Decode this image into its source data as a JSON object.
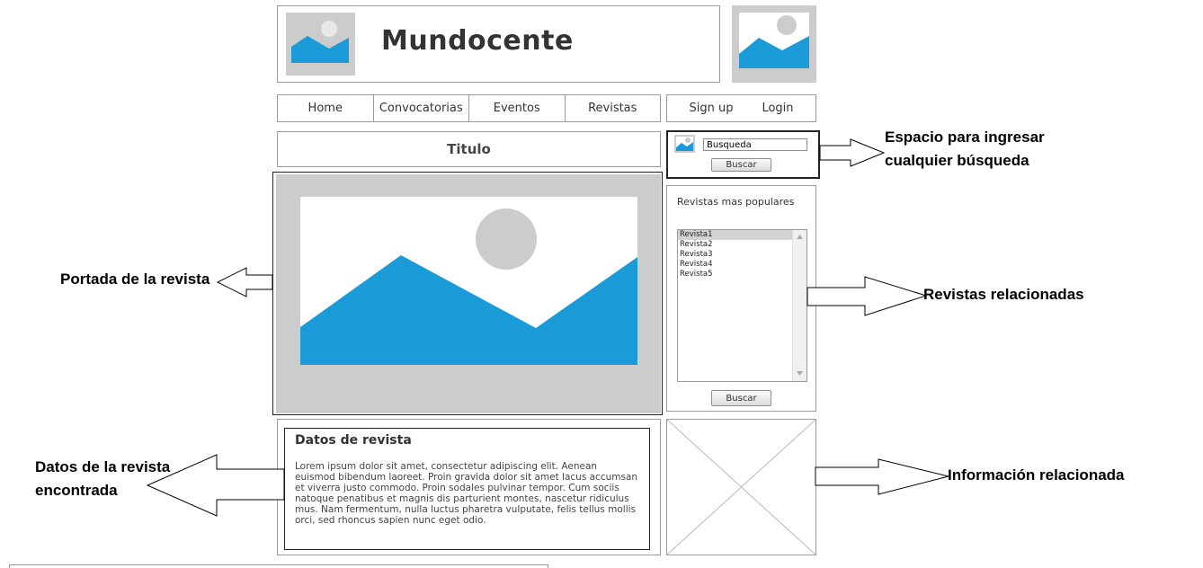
{
  "header": {
    "site_title": "Mundocente"
  },
  "nav": {
    "items": [
      {
        "label": "Home"
      },
      {
        "label": "Convocatorias"
      },
      {
        "label": "Eventos"
      },
      {
        "label": "Revistas"
      }
    ],
    "signup_label": "Sign up",
    "login_label": "Login"
  },
  "main": {
    "title": "Titulo"
  },
  "search": {
    "value": "Busqueda",
    "button_label": "Buscar"
  },
  "popular": {
    "heading": "Revistas mas populares",
    "items": [
      "Revista1",
      "Revista2",
      "Revista3",
      "Revista4",
      "Revista5"
    ],
    "selected": "Revista1",
    "button_label": "Buscar"
  },
  "details": {
    "heading": "Datos de revista",
    "body": "Lorem ipsum dolor sit amet, consectetur adipiscing elit. Aenean euismod bibendum laoreet. Proin gravida dolor sit amet lacus accumsan et viverra justo commodo. Proin sodales pulvinar tempor. Cum sociis natoque penatibus et magnis dis parturient montes, nascetur ridiculus mus. Nam fermentum, nulla luctus pharetra vulputate, felis tellus mollis orci, sed rhoncus sapien nunc eget odio."
  },
  "annotations": {
    "search_line1": "Espacio para ingresar",
    "search_line2": "cualquier búsqueda",
    "cover": "Portada de la revista",
    "related_journals": "Revistas relacionadas",
    "data_line1": "Datos de la revista",
    "data_line2": "encontrada",
    "related_info": "Información relacionada"
  },
  "colors": {
    "placeholder_gray": "#cccccc",
    "image_blue": "#1a9ad6",
    "border": "#9a9a9a"
  }
}
